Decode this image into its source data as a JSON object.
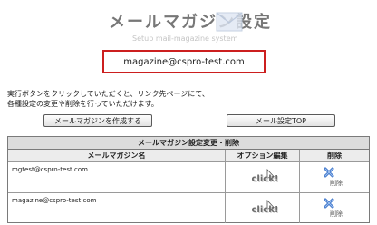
{
  "header": {
    "title": "メールマガジン設定",
    "subtitle": "Setup mail-magazine system",
    "icon": "envelope-icon"
  },
  "email": "magazine@cspro-test.com",
  "instructions": {
    "line1": "実行ボタンをクリックしていただくと、リンク先ページにて、",
    "line2": "各種設定の変更や削除を行っていただけます。"
  },
  "buttons": {
    "create": "メールマガジンを作成する",
    "top": "メール設定TOP"
  },
  "table": {
    "caption": "メールマガジン設定変更・削除",
    "headers": {
      "name": "メールマガジン名",
      "option": "オプション編集",
      "delete": "削除"
    },
    "rows": [
      {
        "name": "mgtest@cspro-test.com",
        "option": "click!",
        "delete": "削除"
      },
      {
        "name": "magazine@cspro-test.com",
        "option": "click!",
        "delete": "削除"
      }
    ]
  },
  "colors": {
    "email_border": "#cc1f1f",
    "caption_bg": "#dcdcdc",
    "icon_blue": "#3a73c9"
  }
}
